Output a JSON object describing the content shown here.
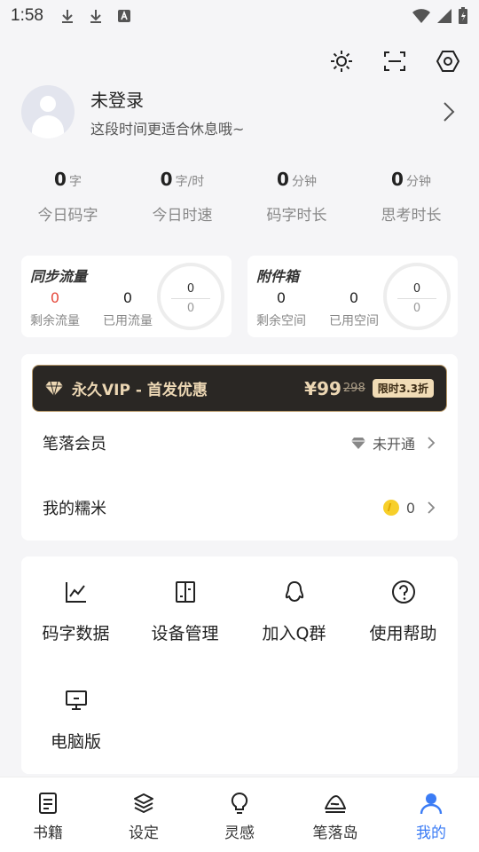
{
  "status_bar": {
    "time": "1:58"
  },
  "profile": {
    "name": "未登录",
    "hint": "这段时间更适合休息哦~"
  },
  "stats": [
    {
      "value": "0",
      "unit": "字",
      "label": "今日码字"
    },
    {
      "value": "0",
      "unit": "字/时",
      "label": "今日时速"
    },
    {
      "value": "0",
      "unit": "分钟",
      "label": "码字时长"
    },
    {
      "value": "0",
      "unit": "分钟",
      "label": "思考时长"
    }
  ],
  "sync": {
    "title": "同步流量",
    "remaining_value": "0",
    "remaining_label": "剩余流量",
    "used_value": "0",
    "used_label": "已用流量",
    "ring_top": "0",
    "ring_bottom": "0"
  },
  "attachments": {
    "title": "附件箱",
    "remaining_value": "0",
    "remaining_label": "剩余空间",
    "used_value": "0",
    "used_label": "已用空间",
    "ring_top": "0",
    "ring_bottom": "0"
  },
  "vip_banner": {
    "title": "永久VIP - 首发优惠",
    "price": "¥99",
    "old_price": "298",
    "tag": "限时3.3折"
  },
  "membership": {
    "label": "笔落会员",
    "status": "未开通"
  },
  "rice": {
    "label": "我的糯米",
    "value": "0"
  },
  "tools": [
    {
      "label": "码字数据",
      "icon": "chart-icon"
    },
    {
      "label": "设备管理",
      "icon": "devices-icon"
    },
    {
      "label": "加入Q群",
      "icon": "qq-icon"
    },
    {
      "label": "使用帮助",
      "icon": "help-icon"
    },
    {
      "label": "电脑版",
      "icon": "desktop-icon"
    }
  ],
  "tabs": [
    {
      "label": "书籍",
      "icon": "book-icon"
    },
    {
      "label": "设定",
      "icon": "layers-icon"
    },
    {
      "label": "灵感",
      "icon": "bulb-icon"
    },
    {
      "label": "笔落岛",
      "icon": "island-icon"
    },
    {
      "label": "我的",
      "icon": "person-icon",
      "active": true
    }
  ],
  "colors": {
    "accent": "#3b7cf5",
    "vip_gold": "#ecd7b4",
    "warning_red": "#e5483b",
    "coin": "#f7cf2a"
  }
}
